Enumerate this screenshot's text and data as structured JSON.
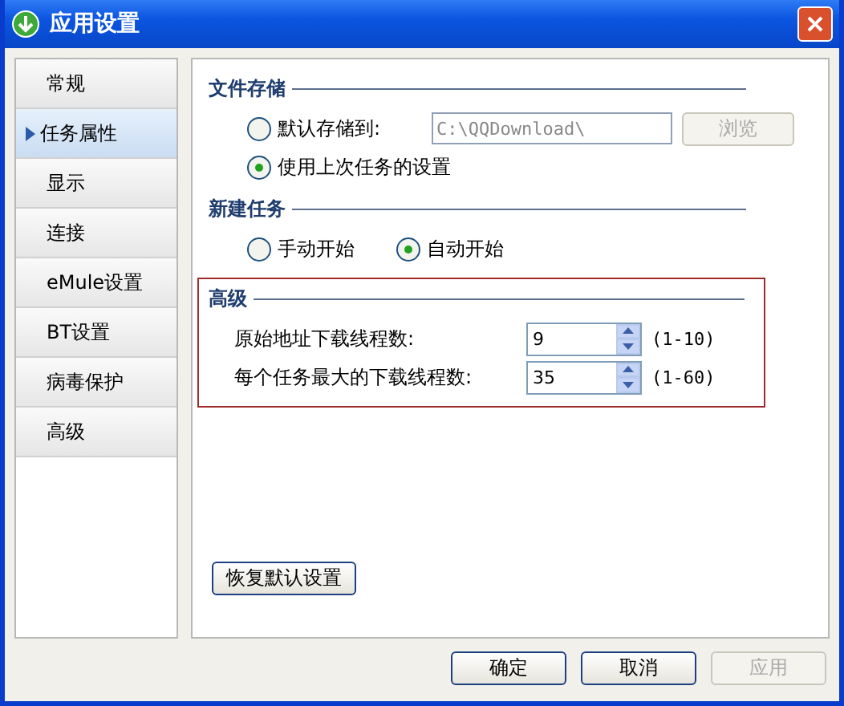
{
  "window": {
    "title": "应用设置"
  },
  "sidebar": {
    "items": [
      {
        "label": "常规",
        "selected": false
      },
      {
        "label": "任务属性",
        "selected": true
      },
      {
        "label": "显示",
        "selected": false
      },
      {
        "label": "连接",
        "selected": false
      },
      {
        "label": "eMule设置",
        "selected": false
      },
      {
        "label": "BT设置",
        "selected": false
      },
      {
        "label": "病毒保护",
        "selected": false
      },
      {
        "label": "高级",
        "selected": false
      }
    ]
  },
  "file_storage": {
    "title": "文件存储",
    "options": [
      {
        "label": "默认存储到:",
        "selected": false,
        "path": "C:\\QQDownload\\",
        "path_disabled": true,
        "browse": {
          "label": "浏览",
          "disabled": true
        }
      },
      {
        "label": "使用上次任务的设置",
        "selected": true
      }
    ]
  },
  "new_task": {
    "title": "新建任务",
    "options": [
      {
        "label": "手动开始",
        "selected": false
      },
      {
        "label": "自动开始",
        "selected": true
      }
    ]
  },
  "advanced": {
    "title": "高级",
    "highlighted": true,
    "fields": [
      {
        "label": "原始地址下载线程数:",
        "value": "9",
        "range": "(1-10)"
      },
      {
        "label": "每个任务最大的下载线程数:",
        "value": "35",
        "range": "(1-60)"
      }
    ]
  },
  "restore_button": "恢复默认设置",
  "buttons": [
    {
      "label": "确定",
      "disabled": false
    },
    {
      "label": "取消",
      "disabled": false
    },
    {
      "label": "应用",
      "disabled": true
    }
  ]
}
